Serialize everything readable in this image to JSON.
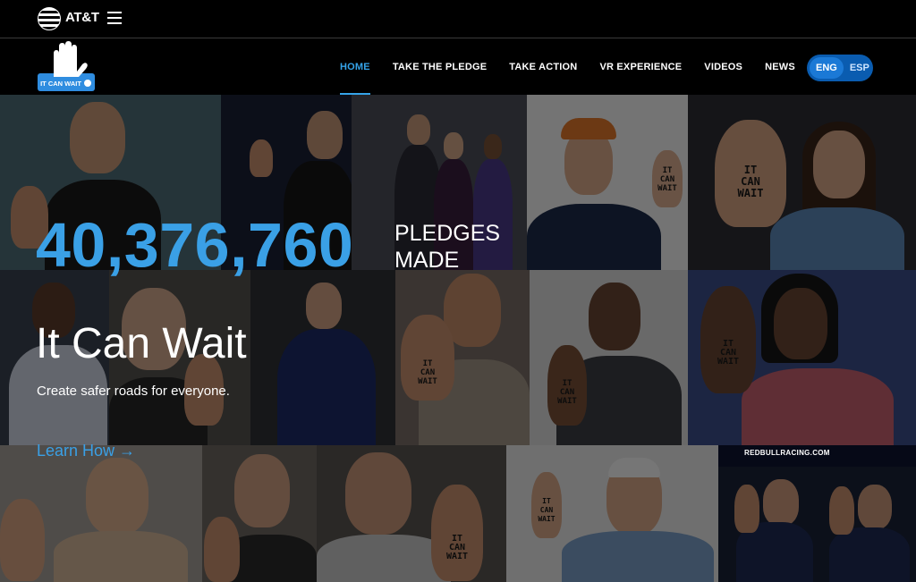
{
  "brand": {
    "name": "AT&T",
    "logo_icon": "att-globe-icon",
    "menu_icon": "hamburger-icon"
  },
  "logo": {
    "text": "IT CAN WAIT",
    "icon": "raised-hand-icon"
  },
  "nav": {
    "items": [
      {
        "label": "HOME",
        "active": true
      },
      {
        "label": "TAKE THE PLEDGE",
        "active": false
      },
      {
        "label": "TAKE ACTION",
        "active": false
      },
      {
        "label": "VR EXPERIENCE",
        "active": false
      },
      {
        "label": "VIDEOS",
        "active": false
      },
      {
        "label": "NEWS",
        "active": false
      }
    ],
    "languages": [
      {
        "label": "ENG",
        "active": true
      },
      {
        "label": "ESP",
        "active": false
      }
    ]
  },
  "hero": {
    "pledge_count": "40,376,760",
    "pledge_label_line1": "PLEDGES",
    "pledge_label_line2": "MADE",
    "title": "It Can Wait",
    "subtitle": "Create safer roads for everyone.",
    "cta": "Learn How →",
    "hand_text": "IT CAN WAIT",
    "sign_text": "REDBULLRACING.COM"
  },
  "colors": {
    "accent": "#35a3e8",
    "lang_toggle": "#0a5cb0",
    "background": "#000000"
  }
}
